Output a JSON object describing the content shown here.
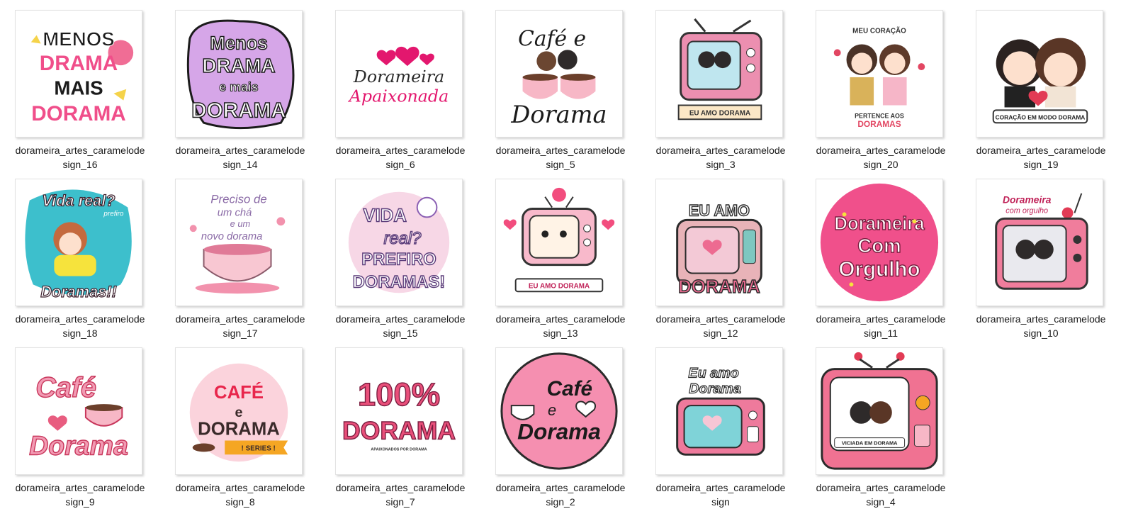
{
  "files": [
    {
      "line1": "dorameira_artes_caramelode",
      "line2": "sign_16",
      "icon": "menos-drama-mais-dorama-sticker",
      "text": [
        "MENOS",
        "DRAMA",
        "MAIS",
        "DORAMA"
      ],
      "accent": "#f04e8a"
    },
    {
      "line1": "dorameira_artes_caramelode",
      "line2": "sign_14",
      "icon": "menos-drama-lilac-sticker",
      "text": [
        "Menos",
        "DRAMA",
        "e mais",
        "DORAMA"
      ],
      "accent": "#c58ad9"
    },
    {
      "line1": "dorameira_artes_caramelode",
      "line2": "sign_6",
      "icon": "dorameira-apaixonada-sticker",
      "text": [
        "Dorameira",
        "Apaixonada"
      ],
      "accent": "#e3176e"
    },
    {
      "line1": "dorameira_artes_caramelode",
      "line2": "sign_5",
      "icon": "cafe-e-dorama-couple-sticker",
      "text": [
        "Café e",
        "Dorama"
      ],
      "accent": "#f1a0b6"
    },
    {
      "line1": "dorameira_artes_caramelode",
      "line2": "sign_3",
      "icon": "tv-eu-amo-dorama-sticker",
      "text": [
        "EU AMO DORAMA"
      ],
      "accent": "#ec8fb0"
    },
    {
      "line1": "dorameira_artes_caramelode",
      "line2": "sign_20",
      "icon": "meu-coracao-couple-sticker",
      "text": [
        "MEU CORAÇÃO",
        "PERTENCE AOS",
        "DORAMAS"
      ],
      "accent": "#e24662"
    },
    {
      "line1": "dorameira_artes_caramelode",
      "line2": "sign_19",
      "icon": "coracao-modo-dorama-sticker",
      "text": [
        "CORAÇÃO EM MODO DORAMA"
      ],
      "accent": "#e23b55"
    },
    {
      "line1": "dorameira_artes_caramelode",
      "line2": "sign_18",
      "icon": "vida-real-girl-sticker",
      "text": [
        "Vida real?",
        "prefiro",
        "Doramas!!"
      ],
      "accent": "#f15a8e"
    },
    {
      "line1": "dorameira_artes_caramelode",
      "line2": "sign_17",
      "icon": "preciso-cha-cup-sticker",
      "text": [
        "Preciso de",
        "um chá",
        "e um",
        "novo dorama"
      ],
      "accent": "#f292ad"
    },
    {
      "line1": "dorameira_artes_caramelode",
      "line2": "sign_15",
      "icon": "vida-real-prefiro-doramas-sticker",
      "text": [
        "VIDA",
        "real?",
        "PREFIRO",
        "DORAMAS!"
      ],
      "accent": "#8a5fb3"
    },
    {
      "line1": "dorameira_artes_caramelode",
      "line2": "sign_13",
      "icon": "tv-cute-face-sticker",
      "text": [
        "EU AMO DORAMA"
      ],
      "accent": "#f0a1bb"
    },
    {
      "line1": "dorameira_artes_caramelode",
      "line2": "sign_12",
      "icon": "eu-amo-dorama-tv-sticker",
      "text": [
        "EU AMO",
        "DORAMA"
      ],
      "accent": "#ed6b91"
    },
    {
      "line1": "dorameira_artes_caramelode",
      "line2": "sign_11",
      "icon": "dorameira-com-orgulho-circle-sticker",
      "text": [
        "Dorameira",
        "Com",
        "Orgulho"
      ],
      "accent": "#f0508b"
    },
    {
      "line1": "dorameira_artes_caramelode",
      "line2": "sign_10",
      "icon": "dorameira-com-orgulho-tv-sticker",
      "text": [
        "Dorameira",
        "com orgulho"
      ],
      "accent": "#f07d9c"
    },
    {
      "line1": "dorameira_artes_caramelode",
      "line2": "sign_9",
      "icon": "cafe-dorama-cup-sticker",
      "text": [
        "Café",
        "Dorama"
      ],
      "accent": "#e85d80"
    },
    {
      "line1": "dorameira_artes_caramelode",
      "line2": "sign_8",
      "icon": "cafe-e-dorama-series-sticker",
      "text": [
        "CAFÉ",
        "e",
        "DORAMA",
        "! SERIES !"
      ],
      "accent": "#e8264c"
    },
    {
      "line1": "dorameira_artes_caramelode",
      "line2": "sign_7",
      "icon": "100-dorama-sticker",
      "text": [
        "100%",
        "DORAMA",
        "APAIXONADOS POR DORAMA"
      ],
      "accent": "#e94f7a"
    },
    {
      "line1": "dorameira_artes_caramelode",
      "line2": "sign_2",
      "icon": "cafe-e-dorama-circle-sticker",
      "text": [
        "Café",
        "e",
        "Dorama"
      ],
      "accent": "#f58fb0"
    },
    {
      "line1": "dorameira_artes_caramelode",
      "line2": "sign",
      "icon": "eu-amo-dorama-tv-hearts-sticker",
      "text": [
        "Eu amo",
        "Dorama"
      ],
      "accent": "#ee7a9c"
    },
    {
      "line1": "dorameira_artes_caramelode",
      "line2": "sign_4",
      "icon": "viciada-em-dorama-tv-sticker",
      "text": [
        "VICIADA EM DORAMA"
      ],
      "accent": "#f07292"
    }
  ]
}
